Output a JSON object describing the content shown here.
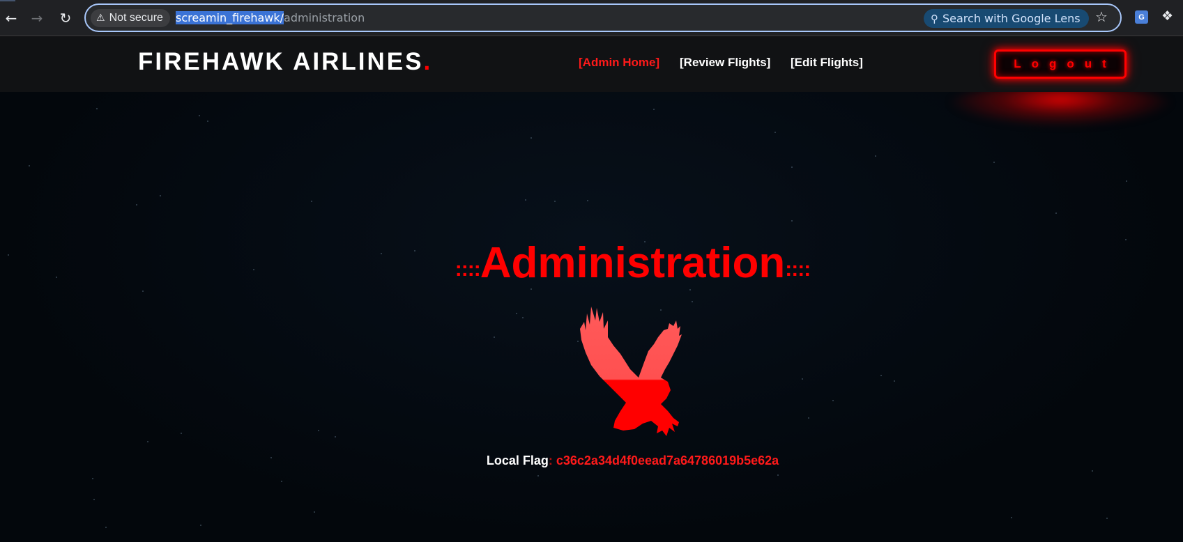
{
  "browser": {
    "security_label": "Not secure",
    "url_host": "screamin_firehawk/",
    "url_path": "administration",
    "lens_label": "Search with Google Lens",
    "icons": {
      "back": "back-arrow-icon",
      "forward": "forward-arrow-icon",
      "reload": "reload-icon",
      "warning": "warning-icon",
      "lens": "search-icon",
      "bookmark": "star-icon",
      "translate": "translate-icon",
      "extensions": "puzzle-icon"
    }
  },
  "site": {
    "brand": "FIREHAWK AIRLINES",
    "brand_dot": ".",
    "nav": [
      {
        "label": "[Admin Home]",
        "active": true
      },
      {
        "label": "[Review Flights]",
        "active": false
      },
      {
        "label": "[Edit Flights]",
        "active": false
      }
    ],
    "logout_label": "Logout"
  },
  "main": {
    "title_left_deco": "::::",
    "title": "Administration",
    "title_right_deco": "::::",
    "logo_icon": "eagle-icon",
    "flag_label": "Local Flag",
    "flag_separator": ":",
    "flag_value": "c36c2a34d4f0eead7a64786019b5e62a"
  },
  "colors": {
    "accent_red": "#ff0000",
    "nav_bg": "#111214",
    "page_bg": "#03070c",
    "eagle_light": "#ff5a5a",
    "eagle_dark": "#ff0000"
  }
}
